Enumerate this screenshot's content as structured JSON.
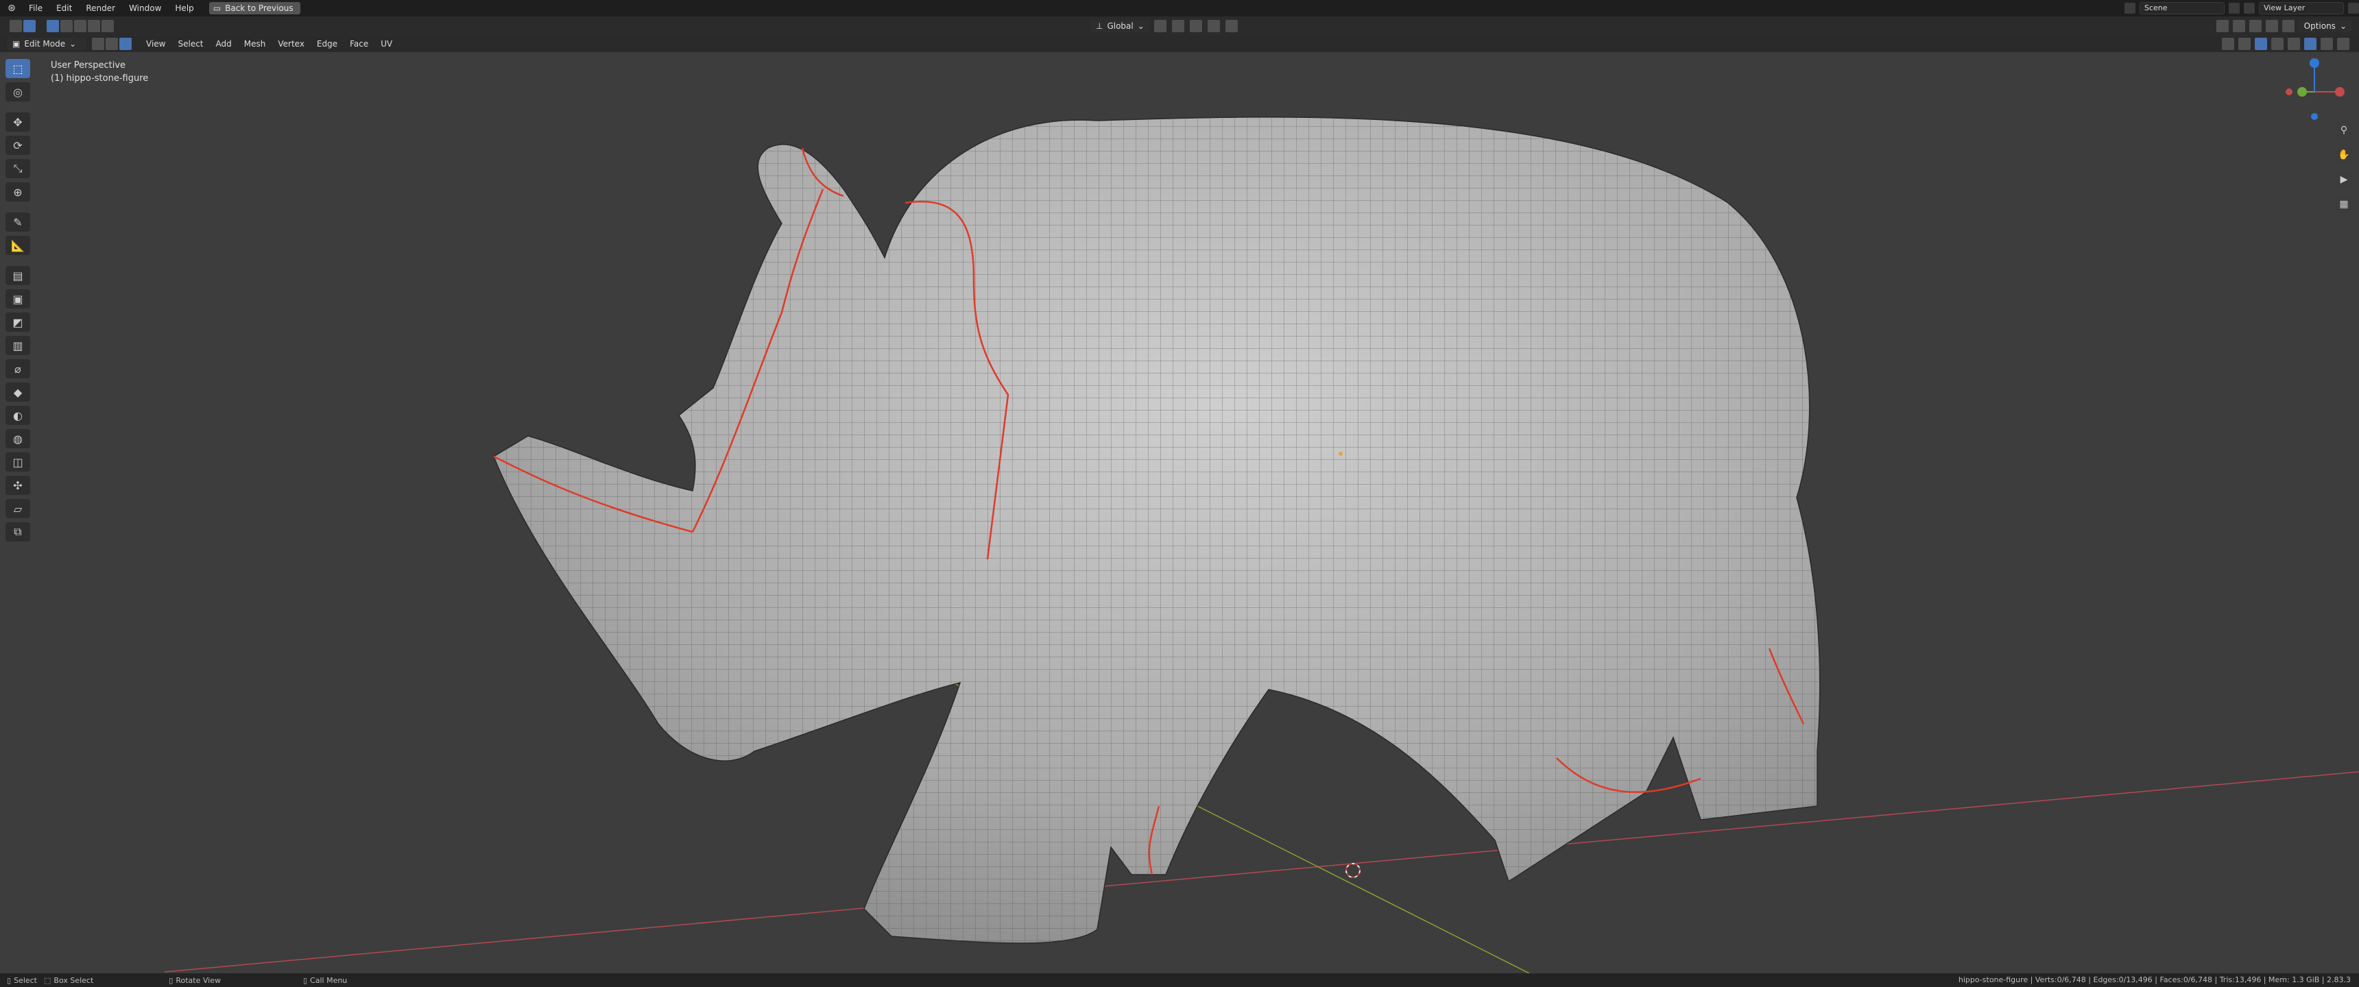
{
  "menu": {
    "items": [
      "File",
      "Edit",
      "Render",
      "Window",
      "Help"
    ],
    "back_button": "Back to Previous"
  },
  "top_right": {
    "scene": "Scene",
    "view_layer": "View Layer"
  },
  "toolbar": {
    "transform_orientation": "Global",
    "options_label": "Options"
  },
  "header": {
    "mode": "Edit Mode",
    "menus": [
      "View",
      "Select",
      "Add",
      "Mesh",
      "Vertex",
      "Edge",
      "Face",
      "UV"
    ]
  },
  "viewport": {
    "perspective": "User Perspective",
    "object": "(1) hippo-stone-figure"
  },
  "statusbar": {
    "select": "Select",
    "box_select": "Box Select",
    "rotate_view": "Rotate View",
    "call_menu": "Call Menu",
    "stats": "hippo-stone-figure | Verts:0/6,748 | Edges:0/13,496 | Faces:0/6,748 | Tris:13,496 | Mem: 1.3 GiB | 2.83.3"
  },
  "colors": {
    "accent": "#4772b3",
    "seam": "#e03a2a",
    "x_axis": "#c0474e",
    "y_axis": "#8aab3a"
  }
}
